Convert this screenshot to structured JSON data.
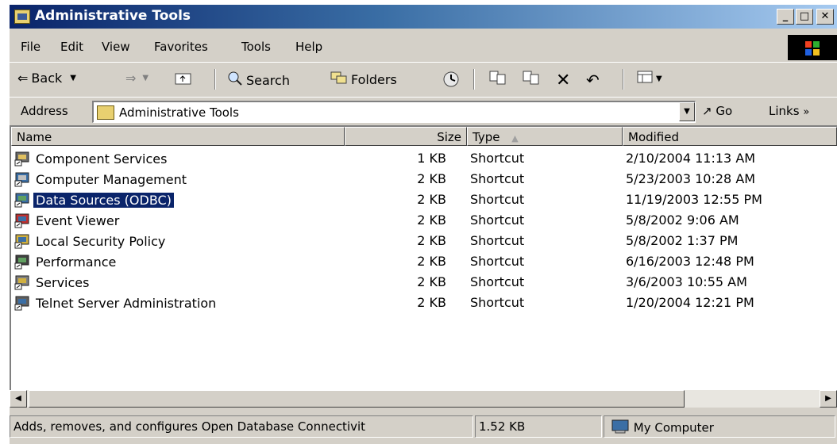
{
  "window": {
    "title": "Administrative Tools",
    "minimize": "_",
    "maximize": "□",
    "close": "✕"
  },
  "menu": [
    "File",
    "Edit",
    "View",
    "Favorites",
    "Tools",
    "Help"
  ],
  "toolbar": {
    "back": "Back",
    "search": "Search",
    "folders": "Folders"
  },
  "address": {
    "label": "Address",
    "value": "Administrative Tools",
    "go": "Go",
    "links": "Links"
  },
  "columns": {
    "name": "Name",
    "size": "Size",
    "type": "Type",
    "modified": "Modified"
  },
  "files": [
    {
      "name": "Component Services",
      "size": "1 KB",
      "type": "Shortcut",
      "modified": "2/10/2004 11:13 AM",
      "selected": false,
      "icon": "component-services-icon"
    },
    {
      "name": "Computer Management",
      "size": "2 KB",
      "type": "Shortcut",
      "modified": "5/23/2003 10:28 AM",
      "selected": false,
      "icon": "computer-management-icon"
    },
    {
      "name": "Data Sources (ODBC)",
      "size": "2 KB",
      "type": "Shortcut",
      "modified": "11/19/2003 12:55 PM",
      "selected": true,
      "icon": "data-sources-icon"
    },
    {
      "name": "Event Viewer",
      "size": "2 KB",
      "type": "Shortcut",
      "modified": "5/8/2002 9:06 AM",
      "selected": false,
      "icon": "event-viewer-icon"
    },
    {
      "name": "Local Security Policy",
      "size": "2 KB",
      "type": "Shortcut",
      "modified": "5/8/2002 1:37 PM",
      "selected": false,
      "icon": "security-policy-icon"
    },
    {
      "name": "Performance",
      "size": "2 KB",
      "type": "Shortcut",
      "modified": "6/16/2003 12:48 PM",
      "selected": false,
      "icon": "performance-icon"
    },
    {
      "name": "Services",
      "size": "2 KB",
      "type": "Shortcut",
      "modified": "3/6/2003 10:55 AM",
      "selected": false,
      "icon": "services-icon"
    },
    {
      "name": "Telnet Server Administration",
      "size": "2 KB",
      "type": "Shortcut",
      "modified": "1/20/2004 12:21 PM",
      "selected": false,
      "icon": "telnet-server-icon"
    }
  ],
  "status": {
    "description": "Adds, removes, and configures Open Database Connectivit",
    "size": "1.52 KB",
    "zone": "My Computer"
  },
  "colors": {
    "title_start": "#0a246a",
    "title_end": "#a6caf0",
    "selection": "#0a246a",
    "chrome": "#d4d0c8"
  }
}
